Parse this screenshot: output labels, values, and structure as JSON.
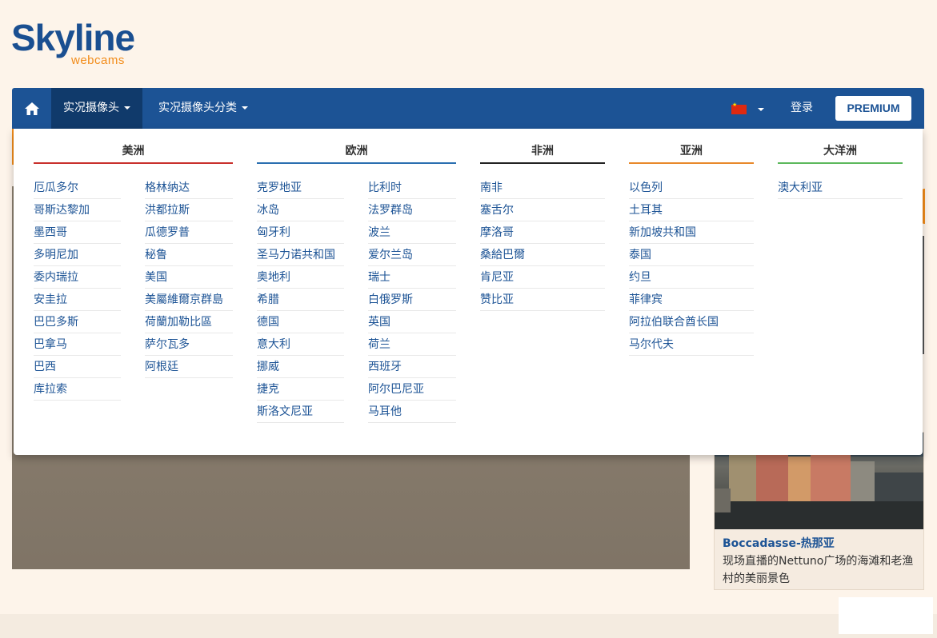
{
  "logo": {
    "main": "Skyline",
    "sub": "webcams"
  },
  "navbar": {
    "home_icon": "home-icon",
    "live_cams": "实况摄像头",
    "categories": "实况摄像头分类",
    "language_flag": "china-flag-icon",
    "login": "登录",
    "premium": "PREMIUM"
  },
  "mega_menu": {
    "americas": {
      "title": "美洲",
      "color": "#c9302c",
      "col1": [
        "厄瓜多尔",
        "哥斯达黎加",
        "墨西哥",
        "多明尼加",
        "委内瑞拉",
        "安圭拉",
        "巴巴多斯",
        "巴拿马",
        "巴西",
        "库拉索"
      ],
      "col2": [
        "格林纳达",
        "洪都拉斯",
        "瓜德罗普",
        "秘鲁",
        "美国",
        "美屬維爾京群島",
        "荷蘭加勒比區",
        "萨尔瓦多",
        "阿根廷"
      ]
    },
    "europe": {
      "title": "欧洲",
      "color": "#2a6fb0",
      "col1": [
        "克罗地亚",
        "冰岛",
        "匈牙利",
        "圣马力诺共和国",
        "奥地利",
        "希腊",
        "德国",
        "意大利",
        "挪威",
        "捷克",
        "斯洛文尼亚"
      ],
      "col2": [
        "比利时",
        "法罗群岛",
        "波兰",
        "爱尔兰岛",
        "瑞士",
        "白俄罗斯",
        "英国",
        "荷兰",
        "西班牙",
        "阿尔巴尼亚",
        "马耳他"
      ]
    },
    "africa": {
      "title": "非洲",
      "color": "#222222",
      "col1": [
        "南非",
        "塞舌尔",
        "摩洛哥",
        "桑給巴爾",
        "肯尼亚",
        "赞比亚"
      ]
    },
    "asia": {
      "title": "亚洲",
      "color": "#e8892a",
      "col1": [
        "以色列",
        "土耳其",
        "新加坡共和国",
        "泰国",
        "约旦",
        "菲律宾",
        "阿拉伯联合酋长国",
        "马尔代夫"
      ]
    },
    "oceania": {
      "title": "大洋洲",
      "color": "#5cb85c",
      "col1": [
        "澳大利亚"
      ]
    }
  },
  "side_card": {
    "title": "Boccadasse-热那亚",
    "description": "现场直播的Nettuno广场的海滩和老渔村的美丽景色"
  }
}
